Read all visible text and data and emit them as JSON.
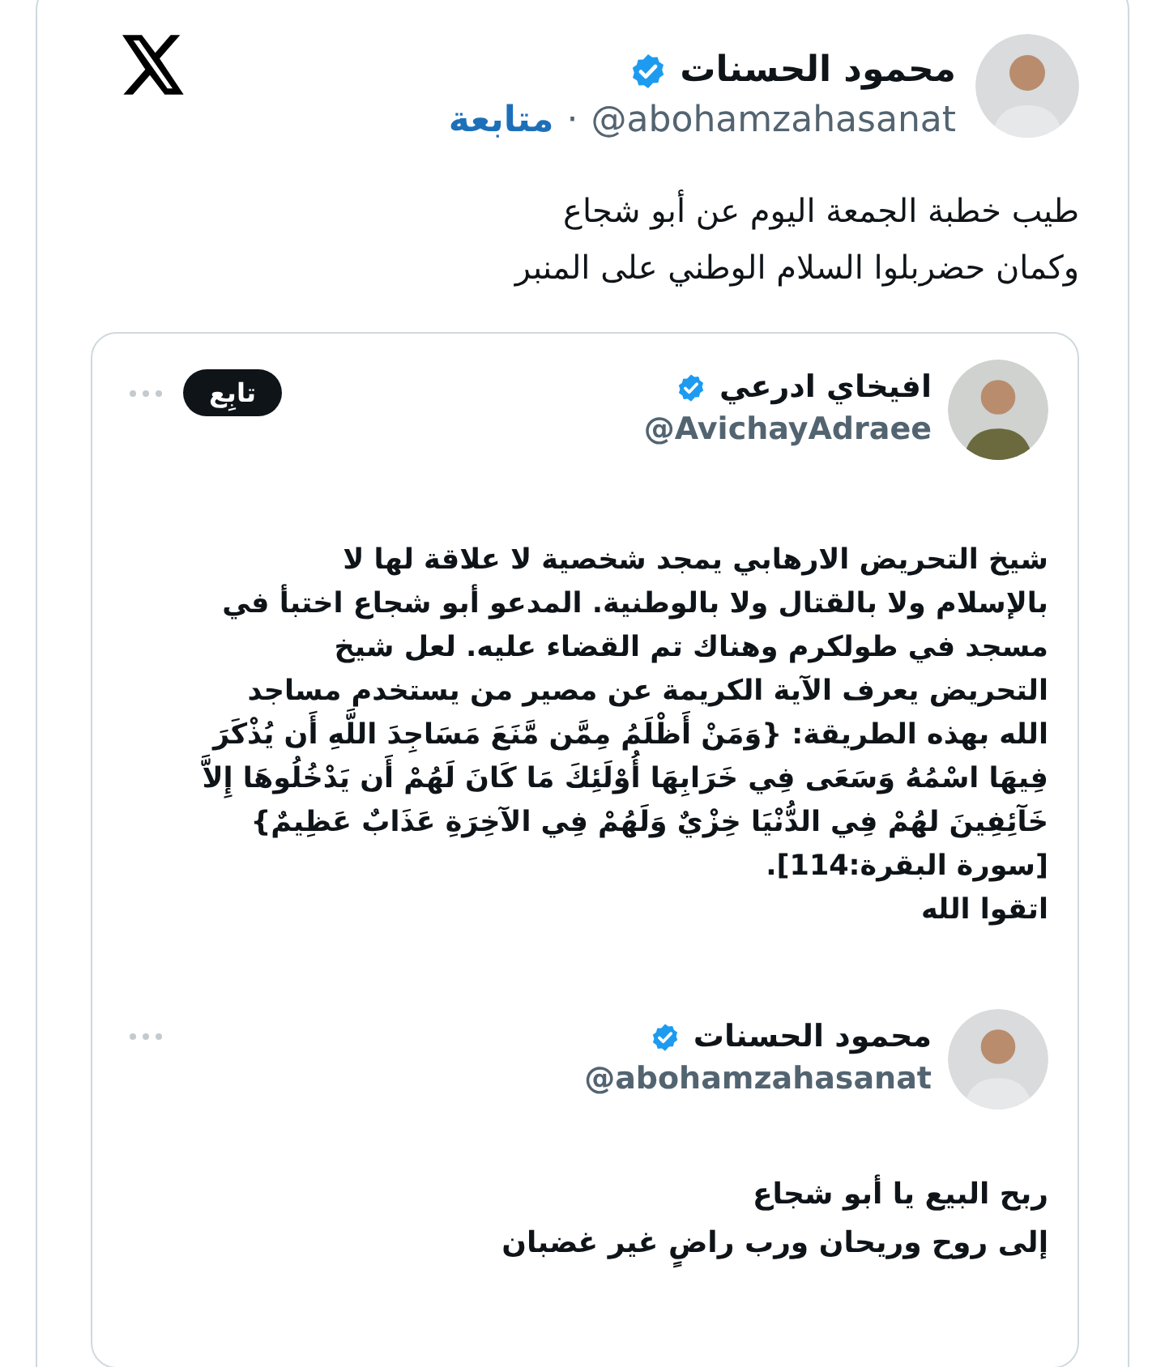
{
  "post": {
    "author": {
      "name": "محمود الحسنات",
      "verified": true,
      "handle": "@abohamzahasanat",
      "separator": "·",
      "follow_link": "متابعة"
    },
    "text_lines": [
      "طيب خطبة الجمعة اليوم عن أبو شجاع",
      "وكمان حضربلوا السلام الوطني على المنبر"
    ],
    "embedded": {
      "author": {
        "name": "افيخاي ادرعي",
        "verified": true,
        "handle": "@AvichayAdraee"
      },
      "follow_button": "تابِع",
      "text_lines": [
        "شيخ التحريض الارهابي يمجد شخصية لا علاقة لها لا",
        "بالإسلام ولا بالقتال ولا بالوطنية. المدعو أبو شجاع اختبأ في",
        "مسجد في طولكرم وهناك تم القضاء عليه. لعل شيخ",
        "التحريض يعرف الآية الكريمة عن مصير من يستخدم مساجد",
        "الله بهذه الطريقة: {وَمَنْ أَظْلَمُ مِمَّن مَّنَعَ مَسَاجِدَ اللَّهِ أَن يُذْكَرَ",
        "فِيهَا اسْمُهُ وَسَعَى فِي خَرَابِهَا أُوْلَئِكَ مَا كَانَ لَهُمْ أَن يَدْخُلُوهَا إِلاَّ",
        "خَآئِفِينَ لهُمْ فِي الدُّنْيَا خِزْيٌ وَلَهُمْ فِي الآخِرَةِ عَذَابٌ عَظِيمٌ}",
        "[سورة البقرة:114].",
        "اتقوا الله"
      ],
      "quoted": {
        "author": {
          "name": "محمود الحسنات",
          "verified": true,
          "handle": "@abohamzahasanat"
        },
        "text_lines": [
          "ربح البيع يا أبو شجاع",
          "إلى روح وريحان ورب راضٍ غير غضبان"
        ]
      }
    }
  }
}
